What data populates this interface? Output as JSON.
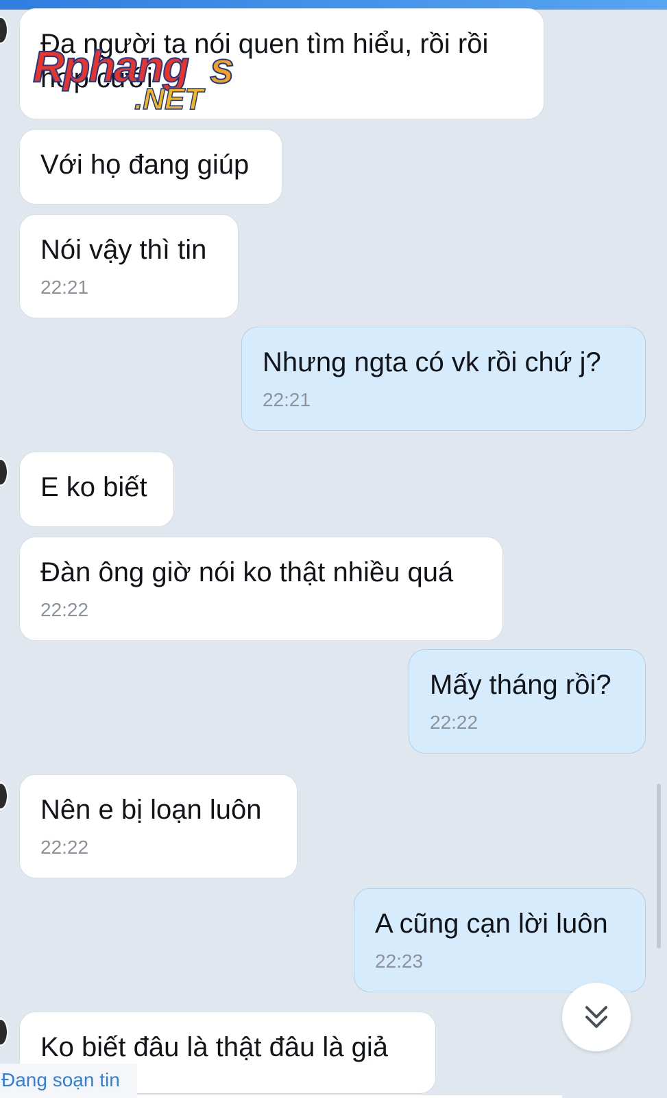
{
  "messages": [
    {
      "lines": [
        "Đa người ta nói quen tìm hiểu, rồi rồi",
        "hợp cưới"
      ],
      "time": "",
      "direction": "in"
    },
    {
      "lines": [
        "Với họ đang giúp"
      ],
      "time": "",
      "direction": "in"
    },
    {
      "lines": [
        "Nói vậy thì tin"
      ],
      "time": "22:21",
      "direction": "in"
    },
    {
      "lines": [
        "Nhưng ngta có vk rồi chứ j?"
      ],
      "time": "22:21",
      "direction": "out"
    },
    {
      "lines": [
        "E ko biết"
      ],
      "time": "",
      "direction": "in"
    },
    {
      "lines": [
        "Đàn ông giờ nói ko thật nhiều quá"
      ],
      "time": "22:22",
      "direction": "in"
    },
    {
      "lines": [
        "Mấy tháng rồi?"
      ],
      "time": "22:22",
      "direction": "out"
    },
    {
      "lines": [
        "Nên e bị loạn luôn"
      ],
      "time": "22:22",
      "direction": "in"
    },
    {
      "lines": [
        "A cũng cạn lời luôn"
      ],
      "time": "22:23",
      "direction": "out"
    },
    {
      "lines": [
        "Ko biết đâu là thật đâu là giả"
      ],
      "time": "",
      "direction": "in"
    }
  ],
  "watermark": {
    "main": "Rphang",
    "s": "s",
    "net": ".NET"
  },
  "status": {
    "typing": "Đang soạn tin"
  },
  "icons": {
    "scroll_down": "double-chevron-down-icon"
  },
  "colors": {
    "incoming_bubble": "#ffffff",
    "outgoing_bubble": "#d6ecfc",
    "accent": "#2f7ee0"
  }
}
